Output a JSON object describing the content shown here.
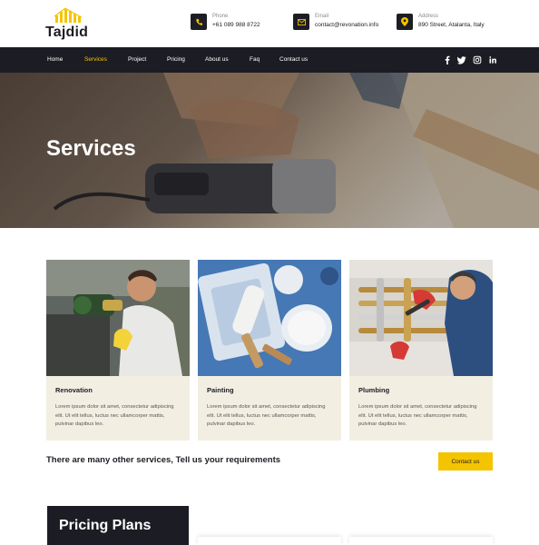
{
  "brand": {
    "name": "Tajdid",
    "accent": "#f5c400",
    "dark": "#1c1c24"
  },
  "contacts": [
    {
      "label": "Phone",
      "value": "+61 089 988 8722",
      "icon": "phone-icon"
    },
    {
      "label": "Email",
      "value": "contact@revonation.info",
      "icon": "mail-icon"
    },
    {
      "label": "Address",
      "value": "890 Street, Atalanta, Italy",
      "icon": "map-pin-icon"
    }
  ],
  "nav": {
    "items": [
      "Home",
      "Services",
      "Project",
      "Pricing",
      "About us",
      "Faq",
      "Contact us"
    ],
    "active": "Services",
    "social": [
      "f",
      "twitter",
      "instagram",
      "in"
    ]
  },
  "hero": {
    "title": "Services"
  },
  "services": [
    {
      "title": "Renovation",
      "description": "Lorem ipsum dolor sit amet, consectetur adipiscing elit. Ut elit tellus, luctus nec ullamcorper mattis, pulvinar dapibus leo."
    },
    {
      "title": "Painting",
      "description": "Lorem ipsum dolor sit amet, consectetur adipiscing elit. Ut elit tellus, luctus nec ullamcorper mattis, pulvinar dapibus leo."
    },
    {
      "title": "Plumbing",
      "description": "Lorem ipsum dolor sit amet, consectetur adipiscing elit. Ut elit tellus, luctus nec ullamcorper mattis, pulvinar dapibus leo."
    }
  ],
  "cta": {
    "text": "There are many other services, Tell us your requirements",
    "button": "Contact us"
  },
  "pricing": {
    "title": "Pricing Plans"
  }
}
